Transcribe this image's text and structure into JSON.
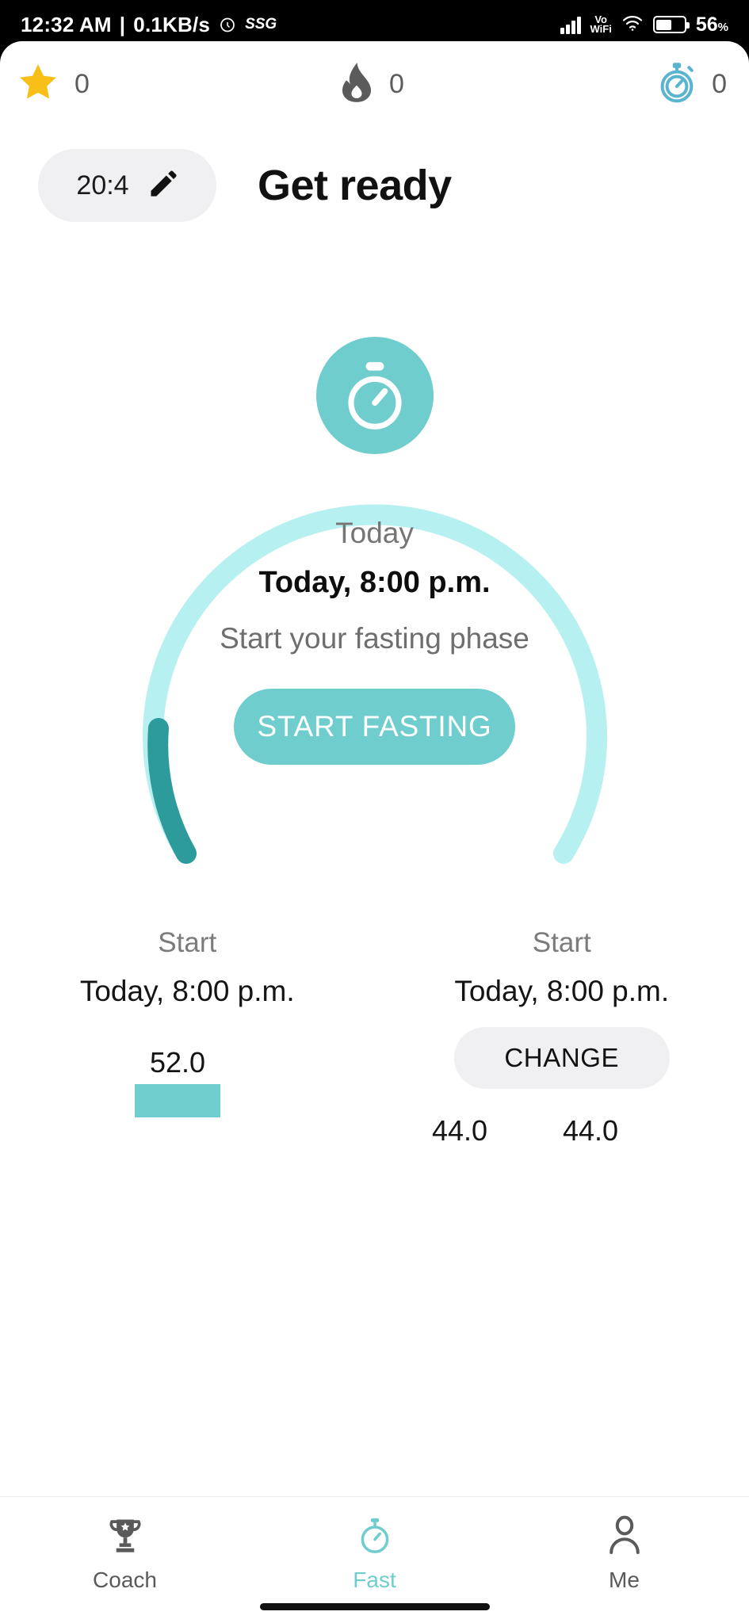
{
  "status_bar": {
    "time": "12:32 AM",
    "separator": "|",
    "network_speed": "0.1KB/s",
    "alarm_icon": "alarm-clock-icon",
    "carrier_tag": "SSG",
    "signal_icon": "cellular-signal-icon",
    "volte_line1": "Vo",
    "volte_line2": "WiFi",
    "wifi_icon": "wifi-icon",
    "battery_icon": "battery-icon",
    "battery_percent": "56",
    "battery_unit": "%",
    "battery_level": 56
  },
  "stats_bar": [
    {
      "icon": "star-icon",
      "value": "0",
      "color": "#f9bf19"
    },
    {
      "icon": "flame-icon",
      "value": "0",
      "color": "#5b5b5b"
    },
    {
      "icon": "stopwatch-icon",
      "value": "0",
      "color": "#5ab4cf"
    }
  ],
  "header": {
    "plan_label": "20:4",
    "edit_icon": "pencil-edit-icon",
    "title": "Get ready"
  },
  "badge": {
    "icon": "stopwatch-icon",
    "background": "#6fcdcd"
  },
  "ring": {
    "track_color": "#b7f0f0",
    "progress_color": "#2d9b9b",
    "progress_percent": 13,
    "today_label": "Today",
    "datetime": "Today, 8:00 p.m.",
    "subtitle": "Start your fasting phase",
    "start_button": "START FASTING"
  },
  "columns": [
    {
      "label": "Start",
      "value": "Today, 8:00 p.m.",
      "action": null
    },
    {
      "label": "Start",
      "value": "Today, 8:00 p.m.",
      "action": "CHANGE"
    }
  ],
  "chart_data": {
    "type": "bar",
    "title": "",
    "categories": [
      "",
      "",
      ""
    ],
    "values": [
      52.0,
      44.0,
      44.0
    ],
    "labels": [
      "52.0",
      "44.0",
      "44.0"
    ],
    "bar_color": "#6fcdcd",
    "xlabel": "",
    "ylabel": "",
    "ylim": [
      0,
      60
    ],
    "grid": false,
    "note": "chart is clipped by the viewport; only first bar and its label are fully visible"
  },
  "bottom_nav": [
    {
      "icon": "trophy-icon",
      "label": "Coach",
      "active": false
    },
    {
      "icon": "stopwatch-icon",
      "label": "Fast",
      "active": true
    },
    {
      "icon": "person-icon",
      "label": "Me",
      "active": false
    }
  ],
  "colors": {
    "accent": "#6fcdcd",
    "accent_dark": "#2d9b9b",
    "track": "#b7f0f0",
    "pill_bg": "#f0f0f2",
    "text_primary": "#111111",
    "text_secondary": "#757575"
  }
}
